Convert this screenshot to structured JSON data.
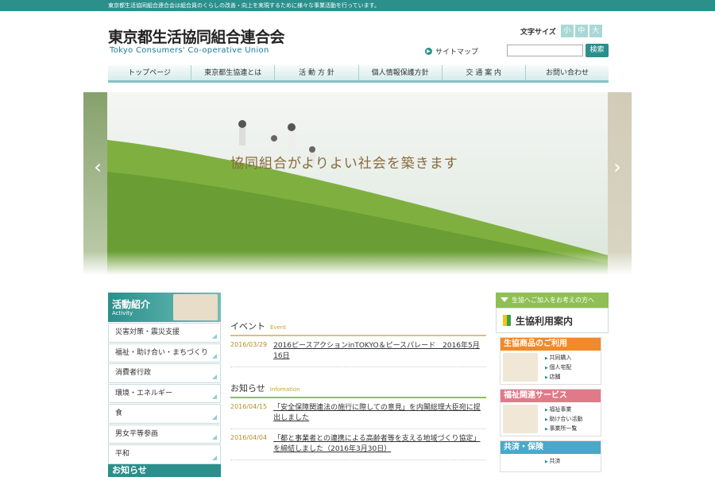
{
  "header": {
    "notice": "東京都生活協同組合連合会は組合員のくらしの改善・向上を実現するために様々な事業活動を行っています。",
    "logo_ja": "東京都生活協同組合連合会",
    "logo_en": "Tokyo Consumers' Co-operative Union",
    "font_size_label": "文字サイズ",
    "font_small": "小",
    "font_medium": "中",
    "font_large": "大",
    "sitemap": "サイトマップ",
    "search_placeholder": "",
    "search_button": "検索"
  },
  "nav": [
    "トップページ",
    "東京都生協連とは",
    "活 動 方 針",
    "個人情報保護方針",
    "交 通 案 内",
    "お問い合わせ"
  ],
  "hero": {
    "tagline": "協同組合がよりよい社会を築きます",
    "prev": "‹",
    "next": "›"
  },
  "activity": {
    "title": "活動紹介",
    "subtitle": "Activity",
    "items": [
      "災害対策・震災支援",
      "福祉・助け合い・まちづくり",
      "消費者行政",
      "環境・エネルギー",
      "食",
      "男女平等参画",
      "平和"
    ]
  },
  "info_title": "お知らせ",
  "event": {
    "title_ja": "イベント",
    "title_en": "Event",
    "items": [
      {
        "date": "2016/03/29",
        "text": "2016ピースアクションinTOKYO＆ピースパレード　2016年5月16日"
      }
    ]
  },
  "news": {
    "title_ja": "お知らせ",
    "title_en": "Infomation",
    "items": [
      {
        "date": "2016/04/15",
        "text": "「安全保障関連法の施行に際しての意見」を内閣総理大臣宛に提出しました"
      },
      {
        "date": "2016/04/04",
        "text": "「都と事業者との連携による高齢者等を支える地域づくり協定」を締結しました（2016年3月30日）"
      }
    ]
  },
  "sidebar": {
    "join": "生協へご加入をお考えの方へ",
    "guide": "生協利用案内",
    "cards": [
      {
        "title": "生協商品のご利用",
        "color": "#f08a2a",
        "items": [
          "共同購入",
          "個人宅配",
          "店舗"
        ]
      },
      {
        "title": "福祉関連サービス",
        "color": "#e07a88",
        "items": [
          "福祉事業",
          "助け合い活動",
          "事業所一覧"
        ]
      },
      {
        "title": "共済・保険",
        "color": "#4aa8c8",
        "items": [
          "共済"
        ]
      }
    ]
  }
}
